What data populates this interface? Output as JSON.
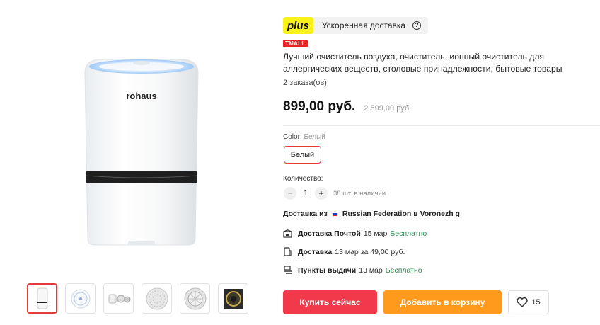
{
  "plus_banner": {
    "logo": "plus",
    "text": "Ускоренная доставка",
    "help_glyph": "?"
  },
  "badge": "TMALL",
  "product": {
    "title": "Лучший очиститель воздуха, очиститель, ионный очиститель для аллергических веществ, столовые принадлежности, бытовые товары",
    "brand": "rohaus",
    "orders": "2 заказа(ов)",
    "price": "899,00 руб.",
    "old_price": "2 599,00 руб."
  },
  "color": {
    "label": "Color:",
    "value": "Белый",
    "option": "Белый"
  },
  "quantity": {
    "label": "Количество:",
    "minus": "−",
    "plus": "+",
    "value": "1",
    "stock": "38 шт. в наличии"
  },
  "shipping": {
    "from_label": "Доставка из",
    "from_location": "Russian Federation в Voronezh g",
    "options": [
      {
        "name": "Доставка Почтой",
        "detail": "15 мар",
        "price": "Бесплатно",
        "icon": "post-icon"
      },
      {
        "name": "Доставка",
        "detail": "13 мар за 49,00 руб.",
        "price": "",
        "icon": "courier-icon"
      },
      {
        "name": "Пункты выдачи",
        "detail": "13 мар",
        "price": "Бесплатно",
        "icon": "pickup-icon"
      }
    ]
  },
  "actions": {
    "buy": "Купить сейчас",
    "cart": "Добавить в корзину",
    "wishlist_count": "15"
  },
  "colors": {
    "accent_red": "#f2394b",
    "accent_orange": "#ff9a1d",
    "plus_yellow": "#f9f11a",
    "free_green": "#2e8b57"
  },
  "gallery": {
    "thumbnails": [
      "purifier-front",
      "purifier-top",
      "purifier-parts",
      "filter-grid",
      "filter-round",
      "filter-dark"
    ],
    "active_index": 0
  }
}
